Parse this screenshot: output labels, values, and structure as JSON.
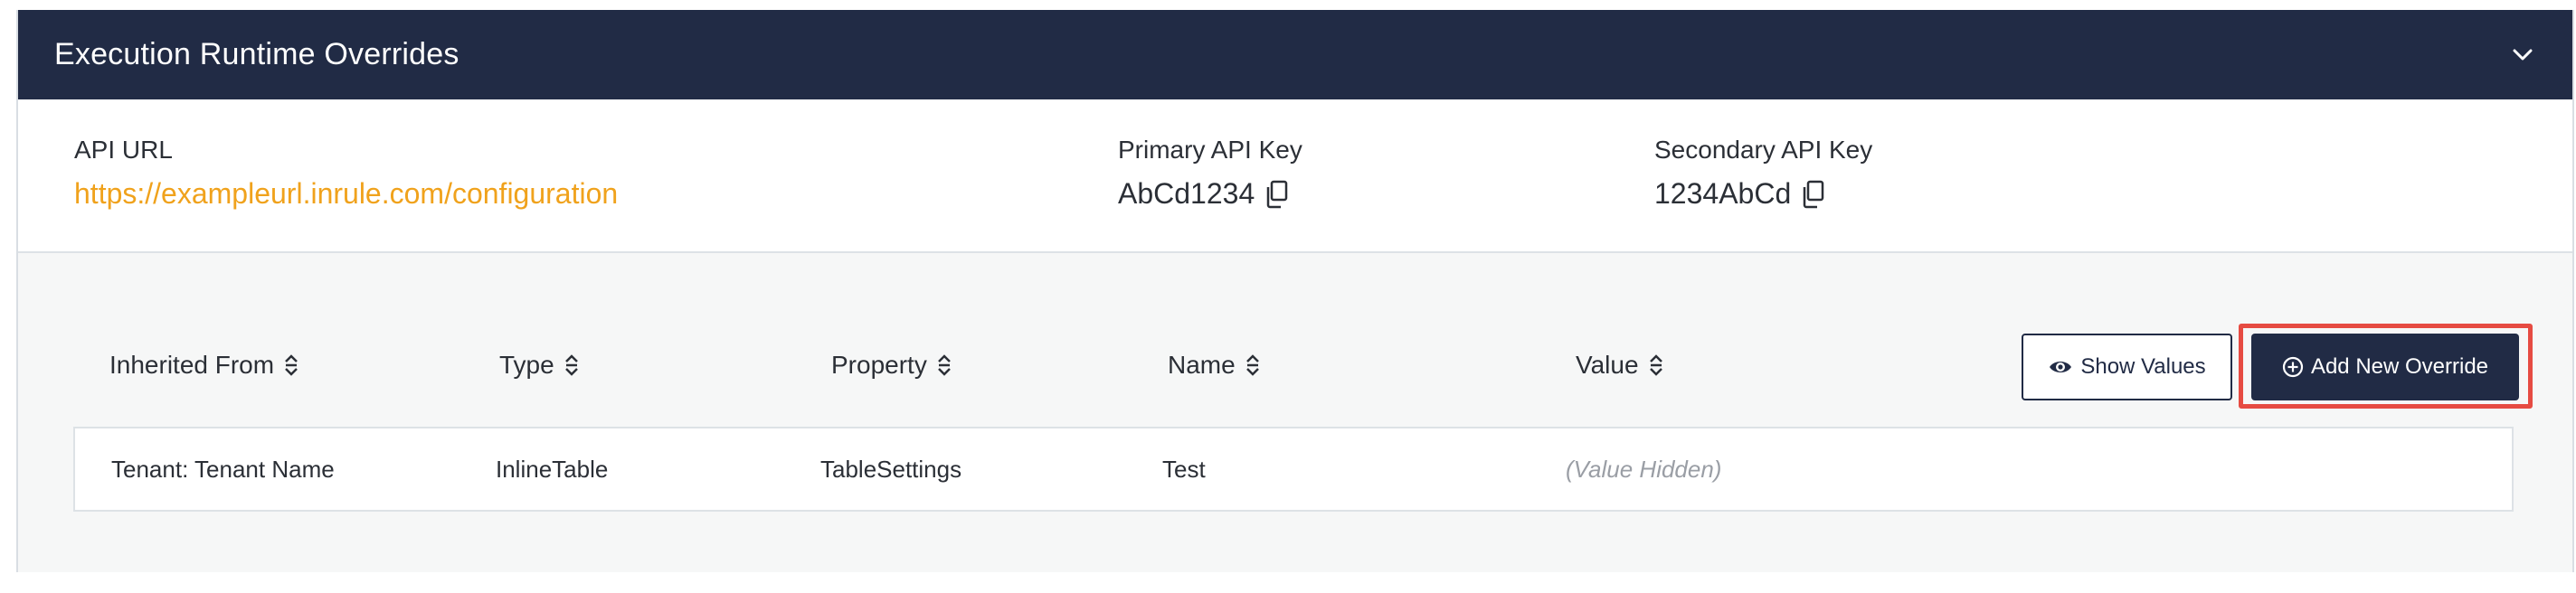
{
  "header": {
    "title": "Execution Runtime Overrides",
    "toggle_icon": "chevron-down-icon"
  },
  "info": {
    "api_url": {
      "label": "API URL",
      "value": "https://exampleurl.inrule.com/configuration"
    },
    "primary_key": {
      "label": "Primary API Key",
      "value": "AbCd1234",
      "icon": "copy-icon"
    },
    "secondary_key": {
      "label": "Secondary API Key",
      "value": "1234AbCd",
      "icon": "copy-icon"
    }
  },
  "table": {
    "columns": [
      {
        "label": "Inherited From",
        "icon": "sort-icon"
      },
      {
        "label": "Type",
        "icon": "sort-icon"
      },
      {
        "label": "Property",
        "icon": "sort-icon"
      },
      {
        "label": "Name",
        "icon": "sort-icon"
      },
      {
        "label": "Value",
        "icon": "sort-icon"
      }
    ],
    "rows": [
      {
        "inherited_from": "Tenant: Tenant Name",
        "type": "InlineTable",
        "property": "TableSettings",
        "name": "Test",
        "value": "(Value Hidden)"
      }
    ]
  },
  "actions": {
    "show_values": {
      "label": "Show Values",
      "icon": "eye-icon"
    },
    "add_override": {
      "label": "Add New Override",
      "icon": "plus-circle-icon"
    }
  },
  "colors": {
    "header_bg": "#212b45",
    "link": "#f0a21c",
    "highlight": "#e64b42",
    "grid_bg": "#f6f7f7"
  }
}
